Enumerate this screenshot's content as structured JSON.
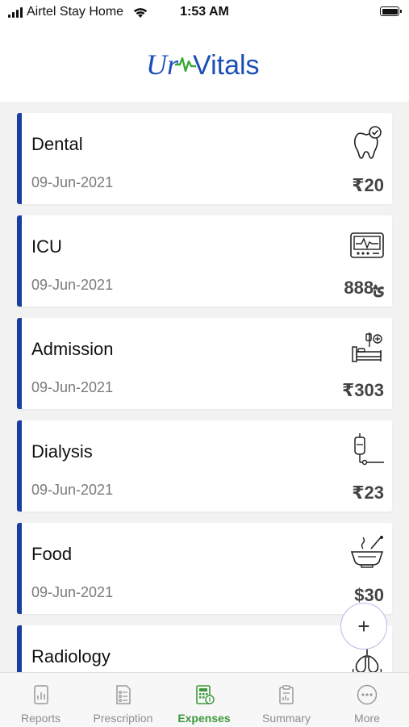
{
  "status": {
    "carrier": "Airtel Stay Home",
    "time": "1:53 AM"
  },
  "header": {
    "logo_prefix": "Ur",
    "logo_suffix": "Vitals"
  },
  "expenses": [
    {
      "title": "Dental",
      "date": "09-Jun-2021",
      "amount": "₹20",
      "icon": "tooth-icon"
    },
    {
      "title": "ICU",
      "date": "09-Jun-2021",
      "amount": "888ؿ",
      "icon": "monitor-icon"
    },
    {
      "title": "Admission",
      "date": "09-Jun-2021",
      "amount": "₹303",
      "icon": "hospital-bed-icon"
    },
    {
      "title": "Dialysis",
      "date": "09-Jun-2021",
      "amount": "₹23",
      "icon": "iv-bag-icon"
    },
    {
      "title": "Food",
      "date": "09-Jun-2021",
      "amount": "$30",
      "icon": "food-bowl-icon"
    },
    {
      "title": "Radiology",
      "date": "",
      "amount": "",
      "icon": "lungs-icon"
    }
  ],
  "fab": {
    "label": "+"
  },
  "tabs": [
    {
      "label": "Reports",
      "icon": "chart-icon",
      "active": false
    },
    {
      "label": "Prescription",
      "icon": "prescription-icon",
      "active": false
    },
    {
      "label": "Expenses",
      "icon": "expenses-icon",
      "active": true
    },
    {
      "label": "Summary",
      "icon": "summary-icon",
      "active": false
    },
    {
      "label": "More",
      "icon": "more-icon",
      "active": false
    }
  ],
  "colors": {
    "accent_bar": "#1b3fa0",
    "active_tab": "#3e9a3e",
    "logo_blue": "#1b4fb5",
    "logo_green": "#3aaa35"
  }
}
